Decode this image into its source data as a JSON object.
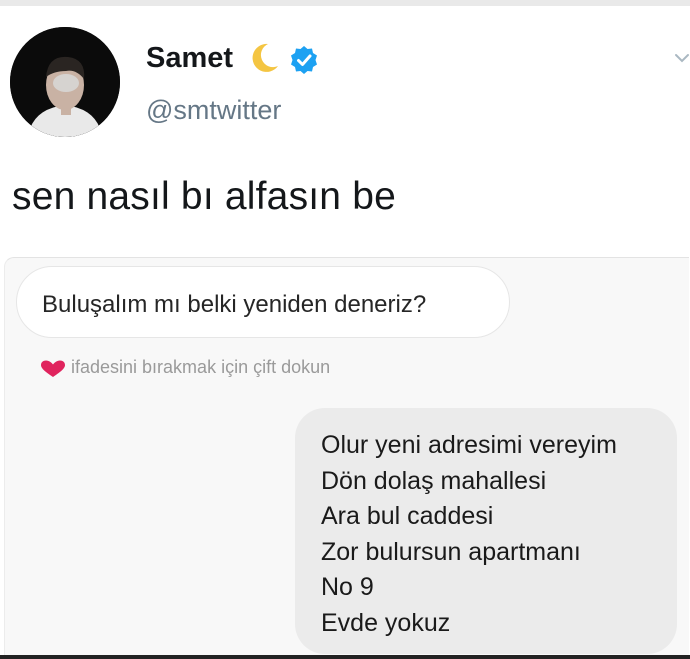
{
  "tweet": {
    "display_name": "Samet",
    "handle": "@smtwitter",
    "text": "sen nasıl bı alfasın be",
    "icons": {
      "moon": "crescent-moon-icon",
      "verified": "verified-badge-icon",
      "menu": "chevron-down-icon",
      "avatar": "avatar"
    },
    "colors": {
      "verified": "#1da1f2",
      "handle": "#657786",
      "text": "#14171a"
    }
  },
  "dm": {
    "received_message": "Buluşalım mı belki yeniden deneriz?",
    "reaction_hint": "ifadesini bırakmak için çift dokun",
    "reaction_icon": "heart-icon",
    "sent_message_lines": [
      "Olur yeni adresimi vereyim",
      "Dön dolaş mahallesi",
      "Ara bul caddesi",
      "Zor bulursun apartmanı",
      "No 9",
      "Evde yokuz"
    ],
    "colors": {
      "heart": "#e0245e",
      "hint": "#9a9a9a",
      "sent_bubble": "#ebebeb",
      "received_bubble": "#ffffff"
    }
  }
}
